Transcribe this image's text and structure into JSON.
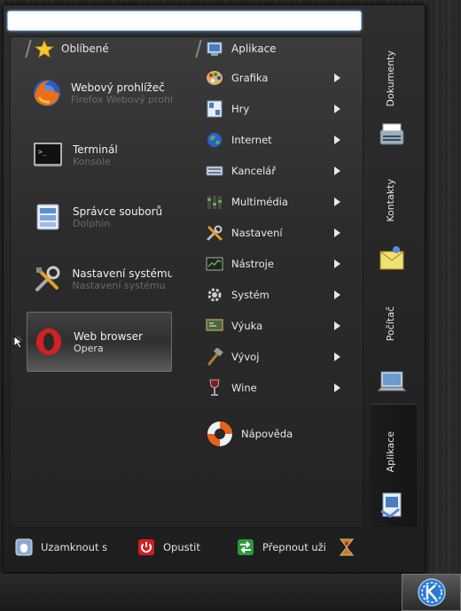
{
  "search": {
    "value": "",
    "placeholder": ""
  },
  "favorites": {
    "header": "Oblíbené",
    "items": [
      {
        "title": "Webový prohlížeč",
        "subtitle": "Firefox Webový prohlížeč",
        "icon": "firefox-icon"
      },
      {
        "title": "Terminál",
        "subtitle": "Konsole",
        "icon": "terminal-icon"
      },
      {
        "title": "Správce souborů",
        "subtitle": "Dolphin",
        "icon": "file-manager-icon"
      },
      {
        "title": "Nastavení systému",
        "subtitle": "Nastavení systému",
        "icon": "system-settings-icon"
      },
      {
        "title": "Web browser",
        "subtitle": "Opera",
        "icon": "opera-icon"
      }
    ]
  },
  "applications": {
    "header": "Aplikace",
    "categories": [
      {
        "label": "Grafika",
        "icon": "palette-icon"
      },
      {
        "label": "Hry",
        "icon": "games-icon"
      },
      {
        "label": "Internet",
        "icon": "globe-icon"
      },
      {
        "label": "Kancelář",
        "icon": "office-icon"
      },
      {
        "label": "Multimédia",
        "icon": "multimedia-icon"
      },
      {
        "label": "Nastavení",
        "icon": "settings-tools-icon"
      },
      {
        "label": "Nástroje",
        "icon": "utilities-icon"
      },
      {
        "label": "Systém",
        "icon": "system-gear-icon"
      },
      {
        "label": "Výuka",
        "icon": "education-icon"
      },
      {
        "label": "Vývoj",
        "icon": "development-hammer-icon"
      },
      {
        "label": "Wine",
        "icon": "wine-glass-icon"
      }
    ],
    "help_label": "Nápověda"
  },
  "sidebar": {
    "tabs": [
      {
        "label": "Dokumenty",
        "icon": "typewriter-icon"
      },
      {
        "label": "Kontakty",
        "icon": "contacts-icon"
      },
      {
        "label": "Počítač",
        "icon": "computer-icon"
      },
      {
        "label": "Aplikace",
        "icon": "applications-icon"
      }
    ],
    "active": "Aplikace"
  },
  "bottom": {
    "lock_label": "Uzamknout s",
    "leave_label": "Opustit",
    "switch_label": "Přepnout uži"
  },
  "colors": {
    "selection_border": "#6c6c6c",
    "search_glow": "#6aa0e6",
    "opera_red": "#d42020"
  }
}
